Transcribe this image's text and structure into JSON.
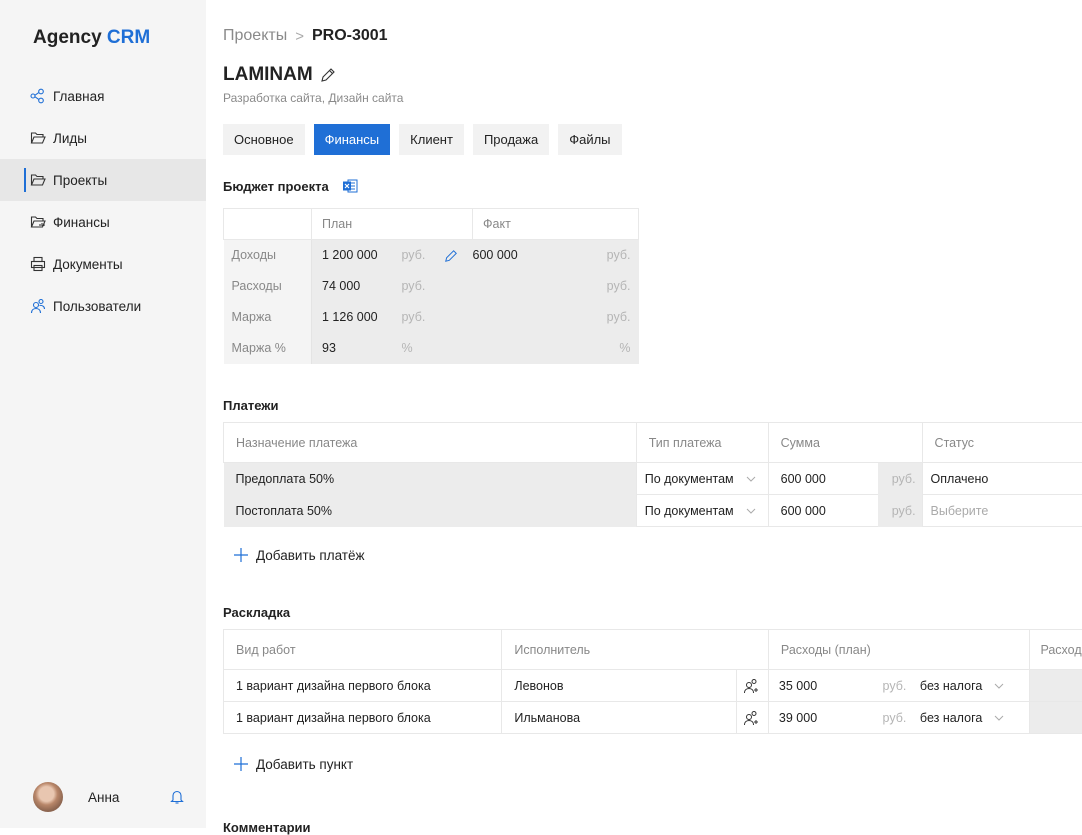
{
  "sidebar": {
    "logo_main": "Agency",
    "logo_accent": "CRM",
    "items": [
      {
        "label": "Главная",
        "icon": "graph-nodes-icon"
      },
      {
        "label": "Лиды",
        "icon": "folder-open-icon"
      },
      {
        "label": "Проекты",
        "icon": "folder-open-icon",
        "active": true
      },
      {
        "label": "Финансы",
        "icon": "folder-chart-icon"
      },
      {
        "label": "Документы",
        "icon": "printer-icon"
      },
      {
        "label": "Пользователи",
        "icon": "users-icon"
      }
    ],
    "user_name": "Анна"
  },
  "breadcrumb": {
    "parent": "Проекты",
    "separator": ">",
    "current": "PRO-3001"
  },
  "project": {
    "title": "LAMINAM",
    "subtitle": "Разработка сайта, Дизайн сайта"
  },
  "tabs": [
    {
      "label": "Основное"
    },
    {
      "label": "Финансы",
      "active": true
    },
    {
      "label": "Клиент"
    },
    {
      "label": "Продажа"
    },
    {
      "label": "Файлы"
    }
  ],
  "budget": {
    "title": "Бюджет проекта",
    "col_plan": "План",
    "col_fact": "Факт",
    "rows": [
      {
        "label": "Доходы",
        "plan": "1 200 000",
        "plan_unit": "руб.",
        "fact": "600 000",
        "fact_unit": "руб."
      },
      {
        "label": "Расходы",
        "plan": "74 000",
        "plan_unit": "руб.",
        "fact": "",
        "fact_unit": "руб."
      },
      {
        "label": "Маржа",
        "plan": "1 126 000",
        "plan_unit": "руб.",
        "fact": "",
        "fact_unit": "руб."
      },
      {
        "label": "Маржа %",
        "plan": "93",
        "plan_unit": "%",
        "fact": "",
        "fact_unit": "%"
      }
    ]
  },
  "payments": {
    "title": "Платежи",
    "headers": [
      "Назначение платежа",
      "Тип платежа",
      "Сумма",
      "Статус"
    ],
    "rows": [
      {
        "purpose": "Предоплата 50%",
        "type": "По документам",
        "amount": "600 000",
        "currency": "руб.",
        "status": "Оплачено"
      },
      {
        "purpose": "Постоплата 50%",
        "type": "По документам",
        "amount": "600 000",
        "currency": "руб.",
        "status": "Выберите"
      }
    ],
    "add_label": "Добавить платёж"
  },
  "layout": {
    "title": "Раскладка",
    "headers": [
      "Вид работ",
      "Исполнитель",
      "Расходы (план)",
      "Расход"
    ],
    "rows": [
      {
        "work": "1 вариант дизайна первого блока",
        "executor": "Левонов",
        "amount": "35 000",
        "currency": "руб.",
        "tax": "без налога"
      },
      {
        "work": "1 вариант дизайна первого блока",
        "executor": "Ильманова",
        "amount": "39 000",
        "currency": "руб.",
        "tax": "без налога"
      }
    ],
    "add_label": "Добавить пункт"
  },
  "comments_title": "Комментарии",
  "colors": {
    "accent": "#1f6fd6",
    "sidebar_bg": "#f5f5f5",
    "cell_bg": "#ececec"
  }
}
